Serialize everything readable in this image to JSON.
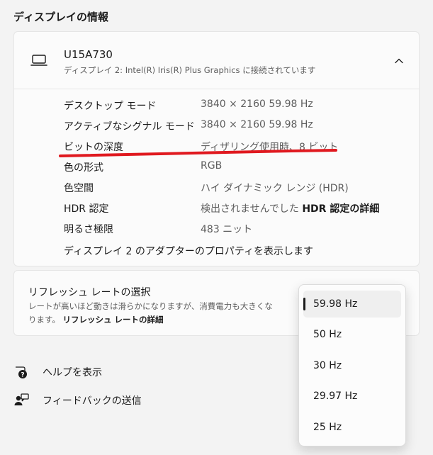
{
  "section_title": "ディスプレイの情報",
  "device": {
    "name": "U15A730",
    "subtitle": "ディスプレイ 2: Intel(R) Iris(R) Plus Graphics に接続されています",
    "icon": "laptop-icon",
    "expand_icon": "chevron-up-icon"
  },
  "info": [
    {
      "label": "デスクトップ モード",
      "value": "3840 × 2160 59.98 Hz"
    },
    {
      "label": "アクティブなシグナル モード",
      "value": "3840 × 2160 59.98 Hz"
    },
    {
      "label": "ビットの深度",
      "value": "ディザリング使用時、8 ビット"
    },
    {
      "label": "色の形式",
      "value": "RGB"
    },
    {
      "label": "色空間",
      "value": "ハイ ダイナミック レンジ (HDR)"
    },
    {
      "label": "HDR 認定",
      "value": "検出されませんでした",
      "link": "HDR 認定の詳細"
    },
    {
      "label": "明るさ極限",
      "value": "483 ニット"
    }
  ],
  "adapter_link": "ディスプレイ 2 のアダプターのプロパティを表示します",
  "refresh": {
    "title": "リフレッシュ レートの選択",
    "desc_line1": "レートが高いほど動きは滑らかになりますが、消費電力も大きくな",
    "desc_line2": "ります。",
    "link": "リフレッシュ レートの詳細",
    "options": [
      "59.98 Hz",
      "50 Hz",
      "30 Hz",
      "29.97 Hz",
      "25 Hz"
    ],
    "selected": "59.98 Hz"
  },
  "help": {
    "label": "ヘルプを表示",
    "icon": "help-icon"
  },
  "feedback": {
    "label": "フィードバックの送信",
    "icon": "feedback-icon"
  },
  "colors": {
    "annotation_red": "#e0191f",
    "accent": "#1b1b1b"
  }
}
